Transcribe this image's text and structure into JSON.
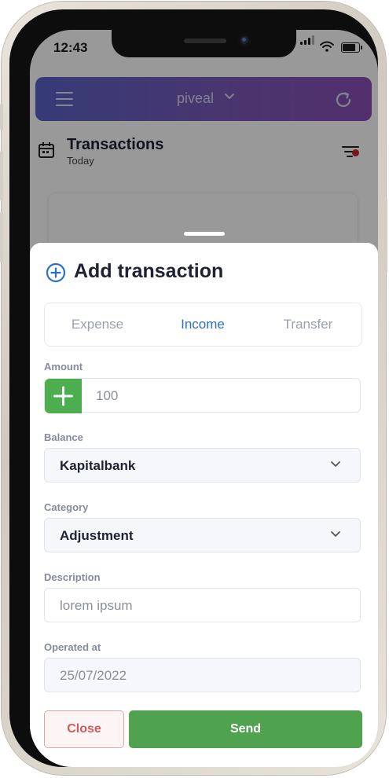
{
  "status_bar": {
    "time": "12:43"
  },
  "header": {
    "workspace": "piveal",
    "menu_icon": "menu-icon",
    "refresh_icon": "refresh-icon"
  },
  "page": {
    "title": "Transactions",
    "subtitle": "Today",
    "calendar_icon": "calendar-icon",
    "filter_icon": "filter-icon"
  },
  "sheet": {
    "title": "Add transaction",
    "tabs": [
      {
        "label": "Expense",
        "active": false
      },
      {
        "label": "Income",
        "active": true
      },
      {
        "label": "Transfer",
        "active": false
      }
    ],
    "amount": {
      "label": "Amount",
      "placeholder": "100"
    },
    "balance": {
      "label": "Balance",
      "value": "Kapitalbank"
    },
    "category": {
      "label": "Category",
      "value": "Adjustment"
    },
    "description": {
      "label": "Description",
      "placeholder": "lorem ipsum"
    },
    "operated_at": {
      "label": "Operated at",
      "value": "25/07/2022"
    },
    "close_label": "Close",
    "send_label": "Send"
  },
  "colors": {
    "accent": "#2b6fc9",
    "income_green": "#4cae4f",
    "send_green": "#4fa34f",
    "close_red": "#cf5b5b",
    "header_start": "#5a63c8",
    "header_end": "#8a4fb6"
  }
}
